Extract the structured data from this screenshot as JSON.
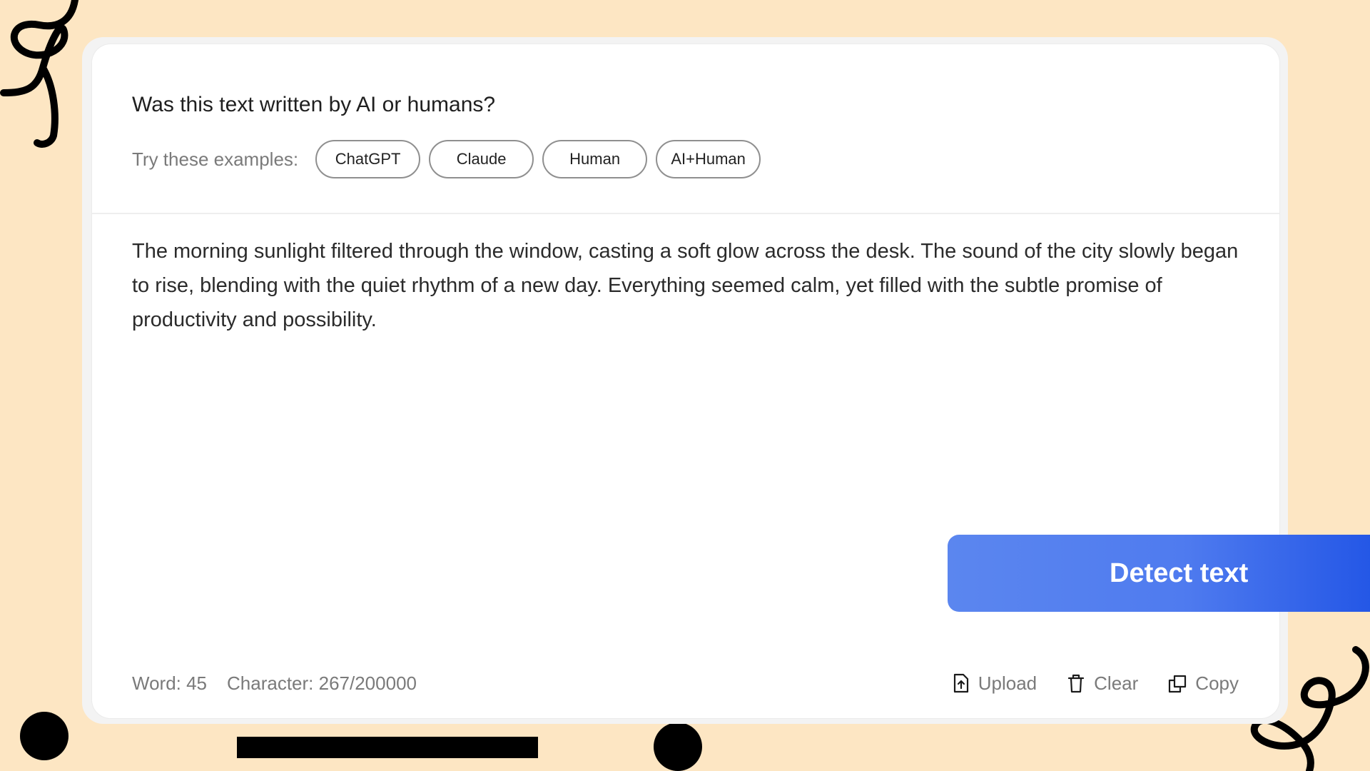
{
  "question": "Was this text written by AI or humans?",
  "examples": {
    "label": "Try these examples:",
    "items": [
      {
        "label": "ChatGPT"
      },
      {
        "label": "Claude"
      },
      {
        "label": "Human"
      },
      {
        "label": "AI+Human"
      }
    ]
  },
  "text_content": "The morning sunlight filtered through the window, casting a soft glow across the desk. The sound of the city slowly began to rise, blending with the quiet rhythm of a new day. Everything seemed calm, yet filled with the subtle promise of productivity and possibility.",
  "detect_button": {
    "label": "Detect text"
  },
  "stats": {
    "word_count": "Word: 45",
    "char_count": "Character: 267/200000"
  },
  "actions": {
    "upload": {
      "label": "Upload",
      "icon": "upload-icon"
    },
    "clear": {
      "label": "Clear",
      "icon": "trash-icon"
    },
    "copy": {
      "label": "Copy",
      "icon": "copy-icon"
    }
  },
  "colors": {
    "background": "#FDE6C3",
    "card": "#FFFFFF",
    "button_gradient_start": "#5B86EF",
    "button_gradient_end": "#2356E6",
    "muted_text": "#7A7A7A"
  }
}
